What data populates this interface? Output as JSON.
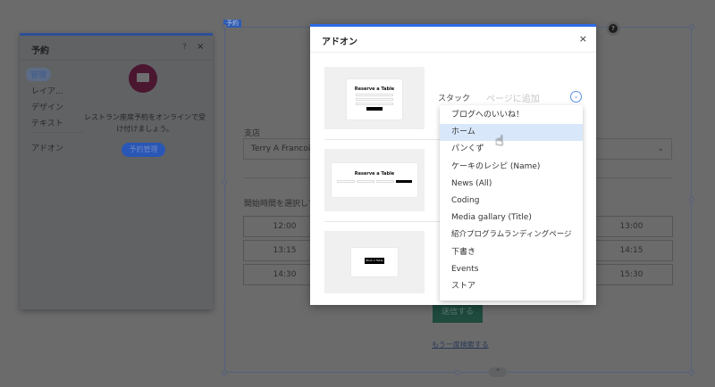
{
  "canvas": {
    "selection_tag": "予約",
    "branch_label": "支店",
    "branch_value": "Terry A Francois B",
    "time_prompt": "開始時間を選択して",
    "time_slots_left": [
      "12:00",
      "13:15",
      "14:30"
    ],
    "time_slots_right": [
      "13:00",
      "14:15",
      "15:30"
    ],
    "submit_label": "送信する",
    "search_again_link": "もう一度検索する"
  },
  "left_panel": {
    "title": "予約",
    "help": "?",
    "close": "×",
    "nav": [
      {
        "label": "管理",
        "active": true
      },
      {
        "label": "レイア..."
      },
      {
        "label": "デザイン"
      },
      {
        "label": "テキスト"
      },
      {
        "label": "アドオン"
      }
    ],
    "description": "レストラン座席予約をオンラインで受け付けましょう。",
    "manage_button": "予約管理"
  },
  "dialog": {
    "title": "アドオン",
    "close": "×",
    "thumb_title": "Reserve a Table",
    "thumb_button": "Book a Table",
    "stack_label": "スタック",
    "add_to_page_placeholder": "ページに追加",
    "dropdown": {
      "highlighted_index": 1,
      "items": [
        "ブログへのいいね！",
        "ホーム",
        "パンくず",
        "ケーキのレシピ (Name)",
        "News (All)",
        "Coding",
        "Media gallary (Title)",
        "紹介プログラムランディングページ",
        "下書き",
        "Events",
        "ストア"
      ]
    }
  },
  "colors": {
    "accent": "#2d6be6",
    "highlight": "#d9e7fb",
    "brand_icon": "#4a1630"
  }
}
